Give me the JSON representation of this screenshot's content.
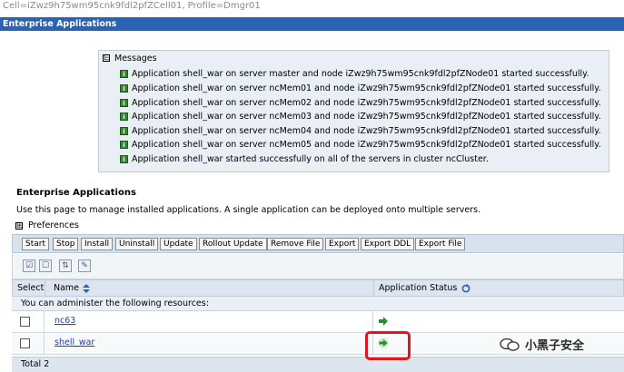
{
  "header": {
    "cell_info": "Cell=iZwz9h75wm95cnk9fdl2pfZCell01, Profile=Dmgr01",
    "title": "Enterprise Applications"
  },
  "messages": {
    "title": "Messages",
    "toggle": "⊟",
    "lines": [
      "Application shell_war on server master and node iZwz9h75wm95cnk9fdl2pfZNode01 started successfully.",
      "Application shell_war on server ncMem01 and node iZwz9h75wm95cnk9fdl2pfZNode01 started successfully.",
      "Application shell_war on server ncMem02 and node iZwz9h75wm95cnk9fdl2pfZNode01 started successfully.",
      "Application shell_war on server ncMem03 and node iZwz9h75wm95cnk9fdl2pfZNode01 started successfully.",
      "Application shell_war on server ncMem04 and node iZwz9h75wm95cnk9fdl2pfZNode01 started successfully.",
      "Application shell_war on server ncMem05 and node iZwz9h75wm95cnk9fdl2pfZNode01 started successfully.",
      "Application shell_war started successfully on all of the servers in cluster ncCluster."
    ]
  },
  "section": {
    "heading": "Enterprise Applications",
    "description": "Use this page to manage installed applications. A single application can be deployed onto multiple servers.",
    "preferences_toggle": "⊞",
    "preferences": "Preferences"
  },
  "toolbar": {
    "start": "Start",
    "stop": "Stop",
    "install": "Install",
    "uninstall": "Uninstall",
    "update": "Update",
    "rollout_update": "Rollout Update",
    "remove_file": "Remove File",
    "export": "Export",
    "export_ddl": "Export DDL",
    "export_file": "Export File"
  },
  "table": {
    "col_select": "Select",
    "col_name": "Name",
    "col_name_sort_icon": "sort-icon",
    "col_status": "Application Status",
    "col_status_icon": "refresh-icon",
    "resources_note": "You can administer the following resources:",
    "rows": [
      {
        "name": "nc63",
        "status_icon": "started-arrow-icon"
      },
      {
        "name": "shell_war",
        "status_icon": "started-arrow-icon"
      }
    ],
    "total": "Total 2"
  },
  "watermark": {
    "text": "小黑子安全"
  },
  "colors": {
    "titlebar": "#2a63b4",
    "message_bg": "#e9eff4",
    "success_green": "#2e8b2e",
    "link": "#1f3fbf",
    "highlight_red": "#e5141a"
  }
}
